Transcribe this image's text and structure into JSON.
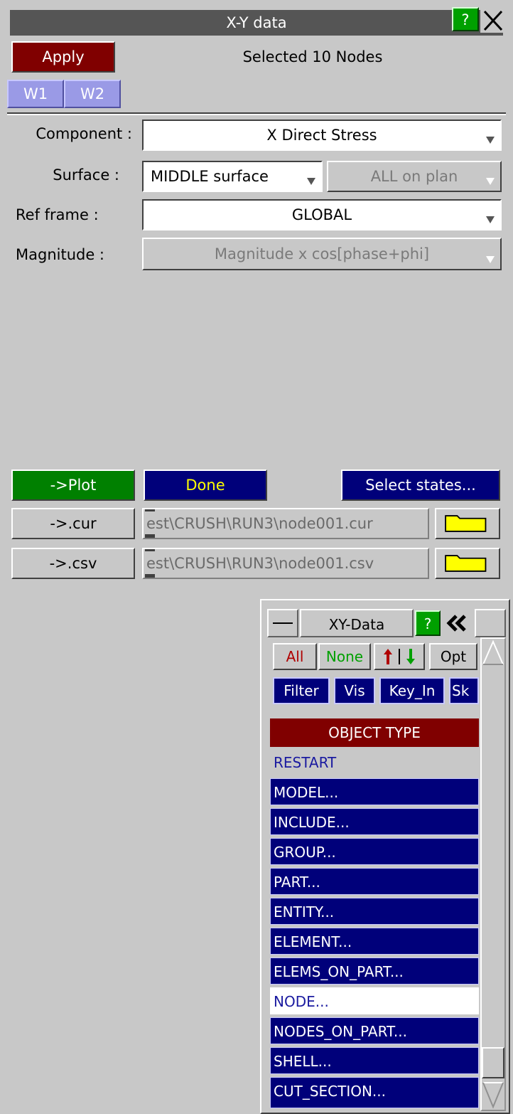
{
  "window": {
    "title": "X-Y data",
    "help_label": "?",
    "close_label": "X"
  },
  "header": {
    "apply_label": "Apply",
    "status_text": "Selected 10 Nodes",
    "tabs": [
      "W1",
      "W2"
    ]
  },
  "form": {
    "component_label": "Component :",
    "component_value": "X Direct Stress",
    "surface_label": "Surface :",
    "surface_value": "MIDDLE surface",
    "surface_plan_value": "ALL on plan",
    "ref_frame_label": "Ref frame :",
    "ref_frame_value": "GLOBAL",
    "magnitude_label": "Magnitude :",
    "magnitude_value": "Magnitude x cos[phase+phi]"
  },
  "actions": {
    "plot_label": "->Plot",
    "done_label": "Done",
    "select_states_label": "Select states...",
    "cur_label": "->.cur",
    "cur_path": "est\\CRUSH\\RUN3\\node001.cur",
    "csv_label": "->.csv",
    "csv_path": "est\\CRUSH\\RUN3\\node001.csv"
  },
  "xy_panel": {
    "title": "XY-Data",
    "help_label": "?",
    "collapse_label": "<<",
    "buttons_row1": [
      "All",
      "None",
      "Opt"
    ],
    "buttons_row2": [
      "Filter",
      "Vis",
      "Key_In",
      "Sk"
    ],
    "object_type_header": "OBJECT TYPE",
    "object_types": [
      "RESTART",
      "MODEL...",
      "INCLUDE...",
      "GROUP...",
      "PART...",
      "ENTITY...",
      "ELEMENT...",
      "ELEMS_ON_PART...",
      "NODE...",
      "NODES_ON_PART...",
      "SHELL...",
      "CUT_SECTION..."
    ],
    "selected_object_type": "NODE..."
  },
  "colors": {
    "apply_bg": "#800000",
    "plot_bg": "#008000",
    "done_bg": "#00007a",
    "done_text": "#ffff00",
    "help_bg": "#00a000",
    "object_header_bg": "#800000",
    "list_item_bg": "#00007a"
  },
  "icons": [
    "question-icon",
    "close-icon",
    "dropdown-arrow-icon",
    "folder-icon",
    "minimize-icon",
    "double-chevron-left-icon",
    "sort-arrows-icon",
    "scroll-up-icon",
    "scroll-down-icon"
  ]
}
